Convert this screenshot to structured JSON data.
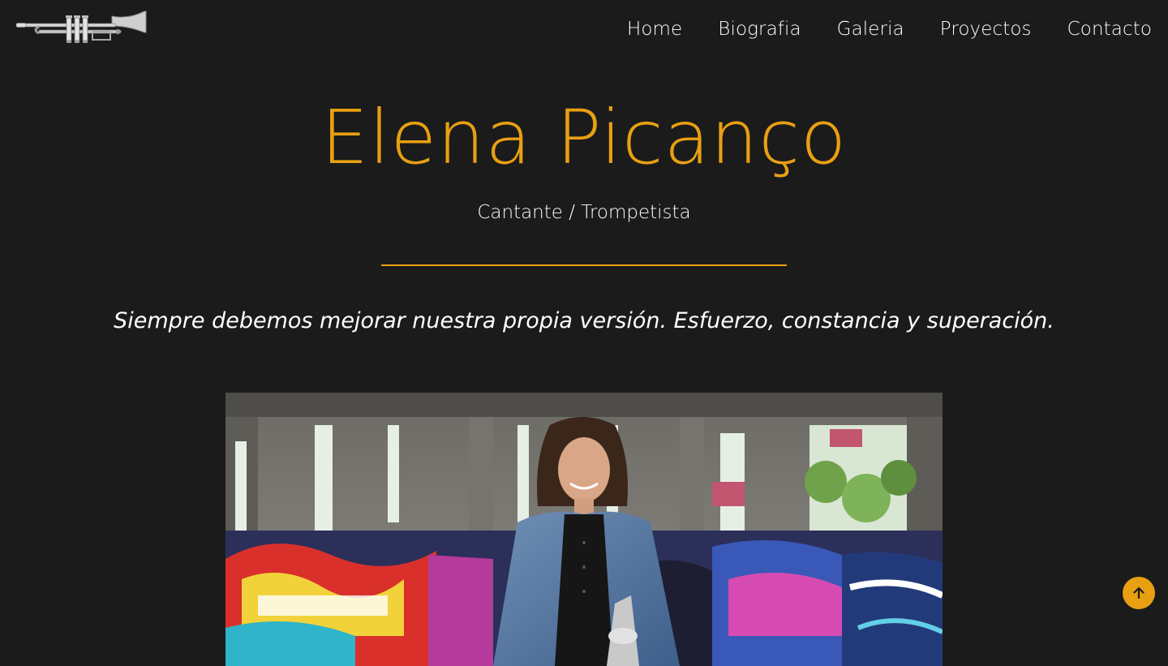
{
  "header": {
    "logo_icon": "trumpet-icon",
    "nav": [
      {
        "label": "Home"
      },
      {
        "label": "Biografia"
      },
      {
        "label": "Galeria"
      },
      {
        "label": "Proyectos"
      },
      {
        "label": "Contacto"
      }
    ]
  },
  "hero": {
    "title": "Elena Picanço",
    "subtitle": "Cantante / Trompetista",
    "quote": "Siempre debemos mejorar nuestra propia versión. Esfuerzo, constancia y superación."
  },
  "photo": {
    "subject": "portrait-photo"
  },
  "back_to_top": {
    "icon": "arrow-up-icon"
  },
  "colors": {
    "background": "#1b1b1b",
    "accent": "#e8a012",
    "text": "#ffffff"
  }
}
